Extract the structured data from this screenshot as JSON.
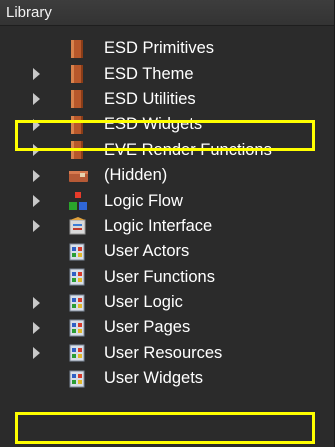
{
  "panel": {
    "title": "Library"
  },
  "tree": {
    "items": [
      {
        "label": "ESD Primitives",
        "icon": "book-icon",
        "expandable": false,
        "highlighted": false
      },
      {
        "label": "ESD Theme",
        "icon": "book-icon",
        "expandable": true,
        "highlighted": false
      },
      {
        "label": "ESD Utilities",
        "icon": "book-icon",
        "expandable": true,
        "highlighted": false
      },
      {
        "label": "ESD Widgets",
        "icon": "book-icon",
        "expandable": true,
        "highlighted": true
      },
      {
        "label": "EVE Render Functions",
        "icon": "book-icon",
        "expandable": true,
        "highlighted": false
      },
      {
        "label": "(Hidden)",
        "icon": "hidden-folder-icon",
        "expandable": true,
        "highlighted": false
      },
      {
        "label": "Logic Flow",
        "icon": "logic-flow-icon",
        "expandable": true,
        "highlighted": false
      },
      {
        "label": "Logic Interface",
        "icon": "logic-interface-icon",
        "expandable": true,
        "highlighted": false
      },
      {
        "label": "User Actors",
        "icon": "user-module-icon",
        "expandable": false,
        "highlighted": false
      },
      {
        "label": "User Functions",
        "icon": "user-module-icon",
        "expandable": false,
        "highlighted": false
      },
      {
        "label": "User Logic",
        "icon": "user-module-icon",
        "expandable": true,
        "highlighted": false
      },
      {
        "label": "User Pages",
        "icon": "user-module-icon",
        "expandable": true,
        "highlighted": false
      },
      {
        "label": "User Resources",
        "icon": "user-module-icon",
        "expandable": true,
        "highlighted": false
      },
      {
        "label": "User Widgets",
        "icon": "user-module-icon",
        "expandable": false,
        "highlighted": true
      }
    ]
  },
  "colors": {
    "panel_bg": "#2b2b2b",
    "text": "#ffffff",
    "highlight": "#ffff00",
    "arrow": "#c8c8c8"
  }
}
